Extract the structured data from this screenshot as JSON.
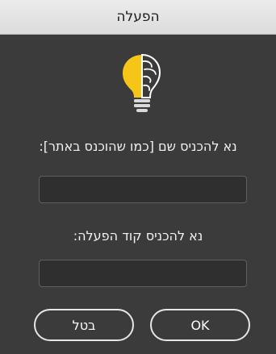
{
  "window": {
    "title": "הפעלה"
  },
  "logo": {
    "icon": "lightbulb-brain-icon",
    "colors": {
      "bulb": "#f5c518",
      "brain": "#ffffff",
      "base": "#d9d9d9"
    }
  },
  "form": {
    "name_label": "נא להכניס שם [כמו שהוכנס באתר]:",
    "name_value": "",
    "code_label": "נא להכניס קוד הפעלה:",
    "code_value": ""
  },
  "buttons": {
    "cancel_label": "בטל",
    "ok_label": "OK"
  }
}
